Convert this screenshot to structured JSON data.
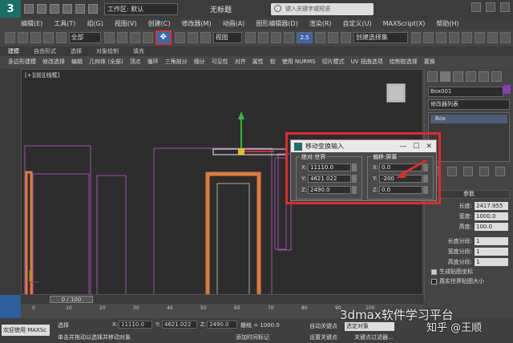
{
  "titlebar": {
    "workspace": "工作区: 默认",
    "doc_title": "无标题",
    "search_placeholder": "键入关键字或短语"
  },
  "menu": [
    "编辑(E)",
    "工具(T)",
    "组(G)",
    "视图(V)",
    "创建(C)",
    "修改器(M)",
    "动画(A)",
    "图形编辑器(D)",
    "渲染(R)",
    "自定义(U)",
    "MAXScript(X)",
    "帮助(H)"
  ],
  "toolbar": {
    "filter": "全部",
    "refcoord": "视图",
    "named_selset": "创建选择集",
    "spinner_value": "2.5",
    "move_icon": "move-tool-icon"
  },
  "ribbon": {
    "tabs": [
      "建模",
      "自由形式",
      "选择",
      "对象绘制",
      "填充"
    ],
    "active_tab": "建模",
    "tools": [
      "多边形建模",
      "修改选择",
      "编辑",
      "几何体 (全部)",
      "顶点",
      "循环",
      "三角剖分",
      "细分",
      "可见性",
      "对齐",
      "属性",
      "软",
      "使用 NURMS",
      "切片模式",
      "UV 扭曲选项",
      "绘制软选择",
      "置换"
    ]
  },
  "viewport": {
    "label": "[+][前][线框]"
  },
  "cmdpanel": {
    "object_name": "Box001",
    "modifier_list": "修改器列表",
    "stack_item": "Box",
    "params_title": "参数",
    "params": [
      {
        "label": "长度:",
        "value": "2417.955"
      },
      {
        "label": "宽度:",
        "value": "1000.0"
      },
      {
        "label": "高度:",
        "value": "100.0"
      }
    ],
    "segments": [
      {
        "label": "长度分段:",
        "value": "1"
      },
      {
        "label": "宽度分段:",
        "value": "1"
      },
      {
        "label": "高度分段:",
        "value": "1"
      }
    ],
    "checks": [
      {
        "label": "生成贴图坐标",
        "checked": true
      },
      {
        "label": "真实世界贴图大小",
        "checked": false
      }
    ]
  },
  "dialog": {
    "title": "移动变换输入",
    "absolute": {
      "title": "绝对:世界",
      "x": "11110.0",
      "y": "4621.022",
      "z": "2490.0"
    },
    "offset": {
      "title": "偏移:屏幕",
      "x": "0.0",
      "y": "-200",
      "z": "0.0"
    },
    "axis_x": "X:",
    "axis_y": "Y:",
    "axis_z": "Z:",
    "ctrl_min": "—",
    "ctrl_max": "☐",
    "ctrl_close": "✕"
  },
  "timeline": {
    "frame": "0 / 100",
    "ticks": [
      "0",
      "10",
      "20",
      "30",
      "40",
      "50",
      "60",
      "70",
      "80",
      "90",
      "100"
    ]
  },
  "statusbar": {
    "welcome": "欢迎使用 MAXSc",
    "selection": "选择",
    "prompt": "单击并拖动以选择并移动对象",
    "x_label": "X:",
    "x_val": "11110.0",
    "y_label": "Y:",
    "y_val": "4621.022",
    "z_label": "Z:",
    "z_val": "2490.0",
    "grid": "栅格 = 1000.0",
    "add_tag": "添加时间标记",
    "autokey": "自动关键点",
    "autokey_value": "选定对象",
    "setkey": "设置关键点",
    "keyfilter": "关键点过滤器..."
  },
  "watermark": {
    "text1": "3dmax软件学习平台",
    "text2": "知乎 @王顺"
  },
  "colors": {
    "highlight_red": "#e02b2b",
    "frame_orange": "#e07a3a",
    "wire_purple": "#a050b0"
  }
}
